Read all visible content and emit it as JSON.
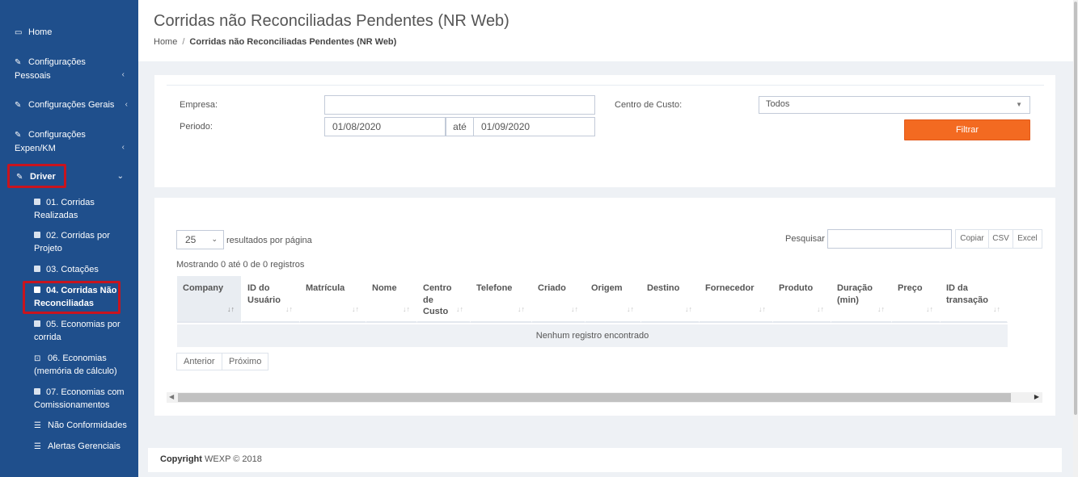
{
  "sidebar": {
    "home": {
      "label": "Home",
      "icon": "monitor-icon"
    },
    "config_pessoais": {
      "line1": "Configurações",
      "line2": "Pessoais"
    },
    "config_gerais": {
      "label": "Configurações Gerais"
    },
    "config_expen": {
      "line1": "Configurações",
      "line2": "Expen/KM"
    },
    "driver": {
      "label": "Driver"
    },
    "sub_items": [
      {
        "line1": "01. Corridas",
        "line2": "Realizadas"
      },
      {
        "line1": "02. Corridas por",
        "line2": "Projeto"
      },
      {
        "line1": "03. Cotações",
        "line2": ""
      },
      {
        "line1": "04. Corridas Não",
        "line2": "Reconciliadas"
      },
      {
        "line1": "05. Economias por",
        "line2": "corrida"
      },
      {
        "line1": "06. Economias",
        "line2": "(memória de cálculo)"
      },
      {
        "line1": "07. Economias com",
        "line2": "Comissionamentos"
      },
      {
        "line1": "Não Conformidades",
        "line2": ""
      },
      {
        "line1": "Alertas Gerenciais",
        "line2": ""
      }
    ]
  },
  "header": {
    "title": "Corridas não Reconciliadas Pendentes (NR Web)",
    "breadcrumb_home": "Home",
    "breadcrumb_sep": "/",
    "breadcrumb_current": "Corridas não Reconciliadas Pendentes (NR Web)"
  },
  "filter": {
    "empresa_label": "Empresa:",
    "empresa_value": "",
    "periodo_label": "Periodo:",
    "date_from": "01/08/2020",
    "ate_label": "até",
    "date_to": "01/09/2020",
    "centro_label": "Centro de Custo:",
    "centro_value": "Todos",
    "filter_button": "Filtrar"
  },
  "table": {
    "page_length": "25",
    "page_length_suffix": "resultados por página",
    "search_label": "Pesquisar",
    "search_value": "",
    "export_buttons": [
      "Copiar",
      "CSV",
      "Excel"
    ],
    "info": "Mostrando 0 até 0 de 0 registros",
    "columns": [
      "Company",
      "ID do Usuário",
      "Matrícula",
      "Nome",
      "Centro de Custo",
      "Telefone",
      "Criado",
      "Origem",
      "Destino",
      "Fornecedor",
      "Produto",
      "Duração (min)",
      "Preço",
      "ID da transação"
    ],
    "empty_message": "Nenhum registro encontrado",
    "prev_label": "Anterior",
    "next_label": "Próximo"
  },
  "footer": {
    "copyright_bold": "Copyright",
    "copyright_rest": "WEXP © 2018"
  },
  "colors": {
    "sidebar": "#1f4f8c",
    "accent_button": "#f36a21",
    "highlight_box": "#c8141e"
  }
}
